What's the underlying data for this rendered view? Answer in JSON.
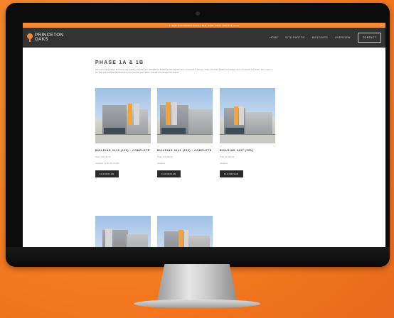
{
  "notice": {
    "text": "2 NEW BUILDINGS AVAILABLE NOW. CALL 609-896-7777",
    "close": "×"
  },
  "logo": {
    "line1": "PRINCETON",
    "line2": "OAKS"
  },
  "nav": {
    "items": [
      "HOME",
      "SITE PHOTOS",
      "BUILDINGS",
      "OVERVIEW"
    ],
    "contact": "CONTACT"
  },
  "page": {
    "heading": "PHASE 1A & 1B",
    "intro": "Princeton Oaks Phase 1 consists of 3 buildings totaling over 300,000 SF. Buildings 100 and 200 were completed in January 2019, and three additional buildings were completed July 2019. This project is the first new industrial development in the past 20 years within Orlando's Northeast sub-market."
  },
  "buildings": [
    {
      "title": "BUILDING 3419 (100) - COMPLETE",
      "size": "Total: 101,344 SF",
      "status": "Available: 9,664 SF-64,800",
      "button": "FLOORPLAN"
    },
    {
      "title": "BUILDING 3401 (200) - COMPLETE",
      "size": "Total: 170,356 SF",
      "status": "Available",
      "button": "FLOORPLAN"
    },
    {
      "title": "BUILDING 3437 (300)",
      "size": "Total: 97,956 SF",
      "status": "Available",
      "button": "FLOORPLAN"
    }
  ],
  "colors": {
    "accent": "#f28a35",
    "nav_bg": "#333333",
    "background": "#f47a20"
  }
}
